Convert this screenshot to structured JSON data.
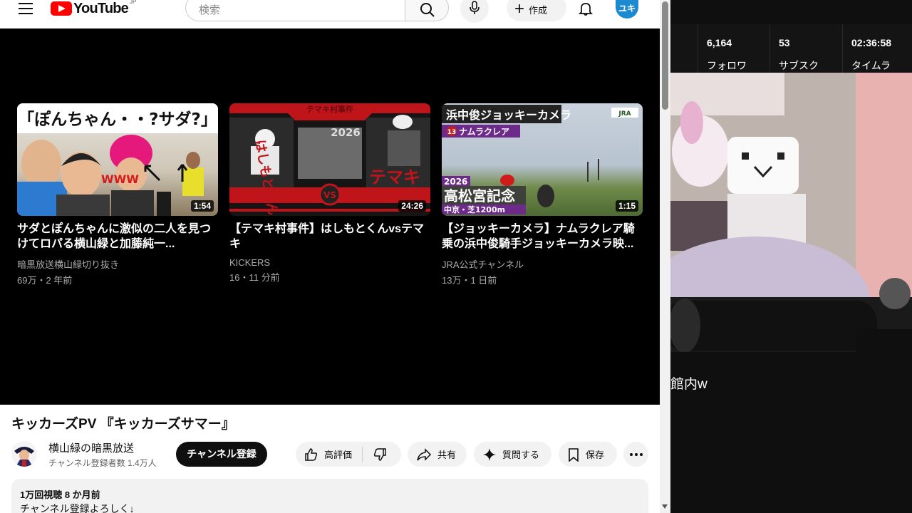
{
  "header": {
    "logo_text": "YouTube",
    "region": "JP",
    "search_placeholder": "検索",
    "create_label": "作成",
    "avatar_text": "ユキ"
  },
  "end_screen": [
    {
      "title": "サダとぽんちゃんに激似の二人を見つけてロパる横山緑と加藤純一...",
      "channel": "暗黒放送横山緑切り抜き",
      "meta": "69万・2 年前",
      "duration": "1:54",
      "thumb_text": "「ぽんちゃん・・?サダ?」",
      "thumb_side": "WWW"
    },
    {
      "title": "【テマキ村事件】はしもとくんvsテマキ",
      "channel": "KICKERS",
      "meta": "16・11 分前",
      "duration": "24:26",
      "thumb_text": "テマキ村事件",
      "thumb_year": "2026",
      "thumb_vs": "VS",
      "thumb_left": "はしもとくん",
      "thumb_right": "テマキ"
    },
    {
      "title": "【ジョッキーカメラ】ナムラクレア騎乗の浜中俊騎手ジョッキーカメラ映...",
      "channel": "JRA公式チャンネル",
      "meta": "13万・1 日前",
      "duration": "1:15",
      "thumb_text": "浜中俊ジョッキーカメラ",
      "thumb_sub": "ナムラクレア",
      "thumb_num": "13",
      "thumb_year": "2026",
      "thumb_race": "高松宮記念",
      "thumb_course": "中京・芝1200m",
      "thumb_logo": "JRA"
    }
  ],
  "video": {
    "title": "キッカーズPV 『キッカーズサマー』",
    "channel_name": "横山緑の暗黒放送",
    "subscribers": "チャンネル登録者数 1.4万人",
    "subscribe_label": "チャンネル登録",
    "like_label": "高評価",
    "share_label": "共有",
    "ask_label": "質問する",
    "save_label": "保存",
    "description": {
      "stats": "1万回視聴 8 か月前",
      "text": "チャンネル登録よろしく↓"
    }
  },
  "stream_stats": [
    {
      "value": "6,164",
      "label": "フォロワ"
    },
    {
      "value": "53",
      "label": "サブスク"
    },
    {
      "value": "02:36:58",
      "label": "タイムラ"
    }
  ],
  "chat_text": "館内w",
  "colors": {
    "youtube_red": "#ff0000",
    "avatar_blue": "#1b8ad0",
    "subscribe_black": "#0f0f0f"
  }
}
